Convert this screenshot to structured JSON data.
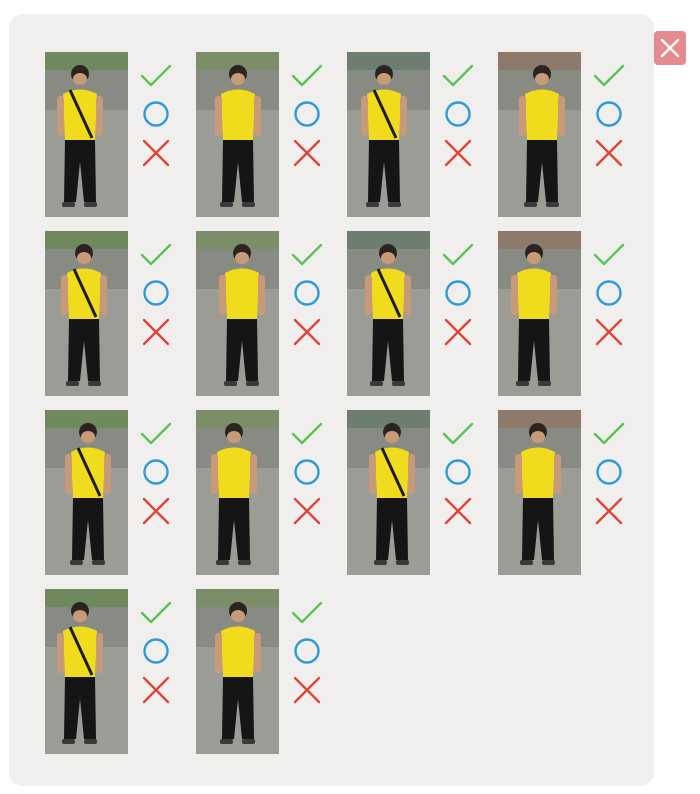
{
  "window": {
    "close_icon": "close-x-icon",
    "close_color": "#e58a8f"
  },
  "colors": {
    "check": "#5cc253",
    "circle": "#2e9bd6",
    "cross": "#e0453a",
    "shirt": "#f0dc1c",
    "panel": "#f1eeee"
  },
  "results": [
    {
      "icons": [
        "check-icon",
        "circle-icon",
        "cross-icon"
      ]
    },
    {
      "icons": [
        "check-icon",
        "circle-icon",
        "cross-icon"
      ]
    },
    {
      "icons": [
        "check-icon",
        "circle-icon",
        "cross-icon"
      ]
    },
    {
      "icons": [
        "check-icon",
        "circle-icon",
        "cross-icon"
      ]
    },
    {
      "icons": [
        "check-icon",
        "circle-icon",
        "cross-icon"
      ]
    },
    {
      "icons": [
        "check-icon",
        "circle-icon",
        "cross-icon"
      ]
    },
    {
      "icons": [
        "check-icon",
        "circle-icon",
        "cross-icon"
      ]
    },
    {
      "icons": [
        "check-icon",
        "circle-icon",
        "cross-icon"
      ]
    },
    {
      "icons": [
        "check-icon",
        "circle-icon",
        "cross-icon"
      ]
    },
    {
      "icons": [
        "check-icon",
        "circle-icon",
        "cross-icon"
      ]
    },
    {
      "icons": [
        "check-icon",
        "circle-icon",
        "cross-icon"
      ]
    },
    {
      "icons": [
        "check-icon",
        "circle-icon",
        "cross-icon"
      ]
    },
    {
      "icons": [
        "check-icon",
        "circle-icon",
        "cross-icon"
      ]
    },
    {
      "icons": [
        "check-icon",
        "circle-icon",
        "cross-icon"
      ]
    }
  ]
}
